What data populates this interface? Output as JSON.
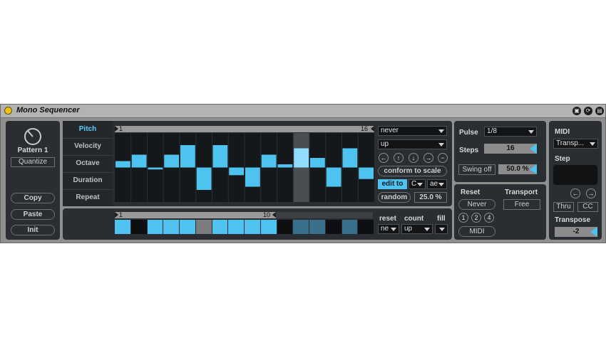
{
  "title": "Mono Sequencer",
  "window_icons": [
    "save-icon",
    "refresh-icon",
    "settings-icon"
  ],
  "pattern": {
    "label": "Pattern 1",
    "quantize": "Quantize",
    "copy": "Copy",
    "paste": "Paste",
    "init": "Init"
  },
  "tabs": [
    {
      "label": "Pitch",
      "active": true
    },
    {
      "label": "Velocity",
      "active": false
    },
    {
      "label": "Octave",
      "active": false
    },
    {
      "label": "Duration",
      "active": false
    },
    {
      "label": "Repeat",
      "active": false
    }
  ],
  "grid": {
    "loop_start": "1",
    "loop_end": "16",
    "steps": [
      {
        "value": 1,
        "highlight": false
      },
      {
        "value": 2,
        "highlight": false
      },
      {
        "value": -0.3,
        "highlight": false
      },
      {
        "value": 2,
        "highlight": false
      },
      {
        "value": 3.5,
        "highlight": false
      },
      {
        "value": -3.5,
        "highlight": false
      },
      {
        "value": 3.5,
        "highlight": false
      },
      {
        "value": -1.2,
        "highlight": false
      },
      {
        "value": -3,
        "highlight": false
      },
      {
        "value": 2,
        "highlight": false
      },
      {
        "value": 0.5,
        "highlight": false
      },
      {
        "value": 3,
        "highlight": true
      },
      {
        "value": 1.5,
        "highlight": false
      },
      {
        "value": -3,
        "highlight": false
      },
      {
        "value": 3,
        "highlight": false
      },
      {
        "value": -1.8,
        "highlight": false
      }
    ]
  },
  "right_controls": {
    "mode1": "never",
    "mode2": "up",
    "arrows": [
      "left-arrow-icon",
      "up-arrow-icon",
      "down-arrow-icon",
      "right-arrow-icon",
      "minus-icon"
    ],
    "conform": "conform to scale",
    "edit_to": "edit to",
    "key": "C",
    "scale": "ae",
    "random": "random",
    "random_amount": "25.0 %"
  },
  "trigger": {
    "loop_start": "1",
    "loop_end": "10",
    "cells": [
      "on",
      "off",
      "on",
      "on",
      "on",
      "gray",
      "on",
      "on",
      "on",
      "on",
      "off",
      "dim",
      "dim",
      "off",
      "dim",
      "off"
    ],
    "reset_label": "reset",
    "count_label": "count",
    "fill_label": "fill",
    "reset_value": "ne",
    "count_value": "up",
    "fill_value": ""
  },
  "timing": {
    "pulse_label": "Pulse",
    "pulse_value": "1/8",
    "steps_label": "Steps",
    "steps_value": "16",
    "swing_label": "Swing off",
    "swing_value": "50.0 %"
  },
  "reset": {
    "label": "Reset",
    "value": "Never",
    "transport_label": "Transport",
    "transport_value": "Free",
    "nums": [
      "1",
      "2",
      "4"
    ],
    "midi": "MIDI"
  },
  "midi": {
    "label": "MIDI",
    "value": "Transp...",
    "step_label": "Step",
    "thru": "Thru",
    "cc": "CC",
    "transpose_label": "Transpose",
    "transpose_value": "-2"
  },
  "colors": {
    "accent": "#4ec3f0",
    "dim": "#3a6f8c",
    "panel": "#2a2d31"
  }
}
